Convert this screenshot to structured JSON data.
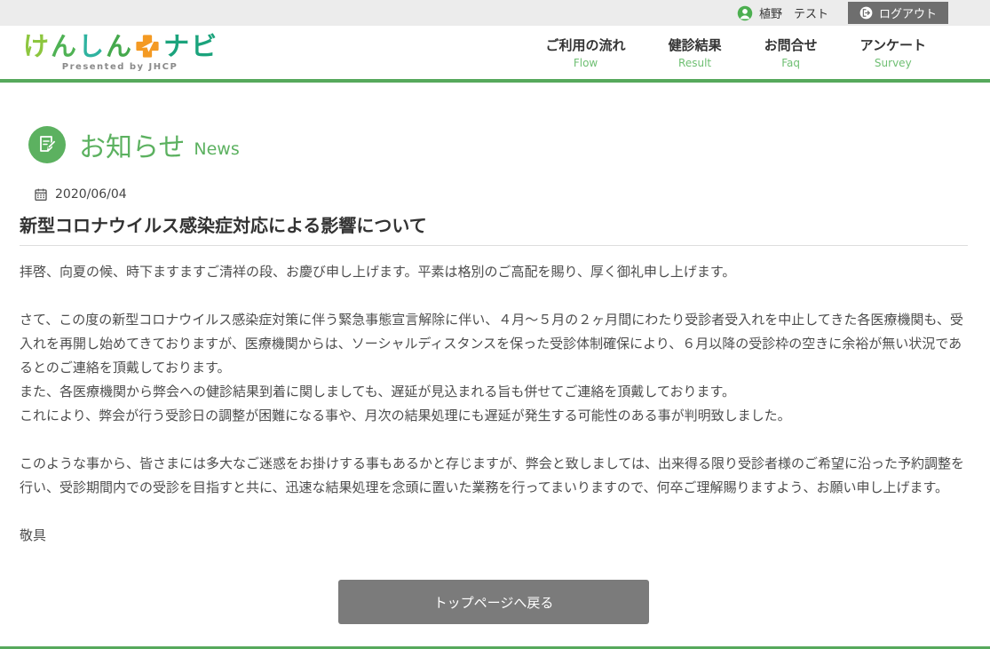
{
  "topbar": {
    "user_name": "植野　テスト",
    "logout_label": "ログアウト"
  },
  "header": {
    "logo": {
      "left": [
        "け",
        "ん",
        "し",
        "ん"
      ],
      "right": [
        "ナ",
        "ビ"
      ],
      "subtitle": "Presented by JHCP"
    },
    "nav": [
      {
        "jp": "ご利用の流れ",
        "en": "Flow"
      },
      {
        "jp": "健診結果",
        "en": "Result"
      },
      {
        "jp": "お問合せ",
        "en": "Faq"
      },
      {
        "jp": "アンケート",
        "en": "Survey"
      }
    ]
  },
  "news": {
    "heading_jp": "お知らせ",
    "heading_en": "News",
    "date": "2020/06/04",
    "title": "新型コロナウイルス感染症対応による影響について",
    "paragraphs": [
      "拝啓、向夏の候、時下ますますご清祥の段、お慶び申し上げます。平素は格別のご高配を賜り、厚く御礼申し上げます。",
      "さて、この度の新型コロナウイルス感染症対策に伴う緊急事態宣言解除に伴い、４月～５月の２ヶ月間にわたり受診者受入れを中止してきた各医療機関も、受入れを再開し始めてきておりますが、医療機関からは、ソーシャルディスタンスを保った受診体制確保により、６月以降の受診枠の空きに余裕が無い状況であるとのご連絡を頂戴しております。\nまた、各医療機関から弊会への健診結果到着に関しましても、遅延が見込まれる旨も併せてご連絡を頂戴しております。\nこれにより、弊会が行う受診日の調整が困難になる事や、月次の結果処理にも遅延が発生する可能性のある事が判明致しました。",
      "このような事から、皆さまには多大なご迷惑をお掛けする事もあるかと存じますが、弊会と致しましては、出来得る限り受診者様のご希望に沿った予約調整を行い、受診期間内での受診を目指すと共に、迅速な結果処理を念頭に置いた業務を行ってまいりますので、何卒ご理解賜りますよう、お願い申し上げます。",
      "敬具"
    ],
    "back_button": "トップページへ戻る"
  },
  "colors": {
    "brand_green": "#56a95c",
    "heading_green": "#5cb160",
    "logo_orange": "#f49a23",
    "logout_gray": "#6e6e6e",
    "button_gray": "#7b7b7b"
  }
}
